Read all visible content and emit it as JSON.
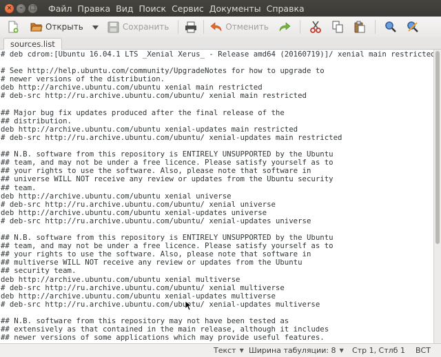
{
  "menubar": {
    "window_buttons": {
      "close": "×",
      "minimize": "–",
      "maximize": "□"
    },
    "items": [
      "Файл",
      "Правка",
      "Вид",
      "Поиск",
      "Сервис",
      "Документы",
      "Справка"
    ]
  },
  "toolbar": {
    "new_icon": "new-document-icon",
    "open_label": "Открыть",
    "save_label": "Сохранить",
    "undo_label": "Отменить"
  },
  "tabs": [
    {
      "label": "sources.list"
    }
  ],
  "editor": {
    "lines": [
      "# deb cdrom:[Ubuntu 16.04.1 LTS _Xenial Xerus_ - Release amd64 (20160719)]/ xenial main restricted",
      "",
      "# See http://help.ubuntu.com/community/UpgradeNotes for how to upgrade to",
      "# newer versions of the distribution.",
      "deb http://archive.ubuntu.com/ubuntu xenial main restricted",
      "# deb-src http://ru.archive.ubuntu.com/ubuntu/ xenial main restricted",
      "",
      "## Major bug fix updates produced after the final release of the",
      "## distribution.",
      "deb http://archive.ubuntu.com/ubuntu xenial-updates main restricted",
      "# deb-src http://ru.archive.ubuntu.com/ubuntu/ xenial-updates main restricted",
      "",
      "## N.B. software from this repository is ENTIRELY UNSUPPORTED by the Ubuntu",
      "## team, and may not be under a free licence. Please satisfy yourself as to",
      "## your rights to use the software. Also, please note that software in",
      "## universe WILL NOT receive any review or updates from the Ubuntu security",
      "## team.",
      "deb http://archive.ubuntu.com/ubuntu xenial universe",
      "# deb-src http://ru.archive.ubuntu.com/ubuntu/ xenial universe",
      "deb http://archive.ubuntu.com/ubuntu xenial-updates universe",
      "# deb-src http://ru.archive.ubuntu.com/ubuntu/ xenial-updates universe",
      "",
      "## N.B. software from this repository is ENTIRELY UNSUPPORTED by the Ubuntu",
      "## team, and may not be under a free licence. Please satisfy yourself as to",
      "## your rights to use the software. Also, please note that software in",
      "## multiverse WILL NOT receive any review or updates from the Ubuntu",
      "## security team.",
      "deb http://archive.ubuntu.com/ubuntu xenial multiverse",
      "# deb-src http://ru.archive.ubuntu.com/ubuntu/ xenial multiverse",
      "deb http://archive.ubuntu.com/ubuntu xenial-updates multiverse",
      "# deb-src http://ru.archive.ubuntu.com/ubuntu/ xenial-updates multiverse",
      "",
      "## N.B. software from this repository may not have been tested as",
      "## extensively as that contained in the main release, although it includes",
      "## newer versions of some applications which may provide useful features."
    ]
  },
  "statusbar": {
    "language": "Текст",
    "tab_width": "Ширина табуляции: 8",
    "position": "Стр 1, Стлб 1",
    "mode": "ВСТ"
  },
  "colors": {
    "menubar_bg": "#3c3b37",
    "close_button": "#e95420",
    "undo_arrow": "#e66a26",
    "redo_arrow": "#4e9a06"
  }
}
